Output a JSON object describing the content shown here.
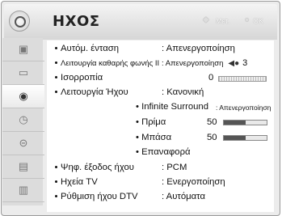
{
  "header": {
    "title": "ΗΧΟΣ",
    "hint_move": "Μετ.",
    "hint_ok": "OK"
  },
  "sidebar": {
    "items": [
      {
        "icon": "picture-icon"
      },
      {
        "icon": "sound-icon"
      },
      {
        "icon": "settings-icon"
      },
      {
        "icon": "time-icon"
      },
      {
        "icon": "lock-icon"
      },
      {
        "icon": "option-icon"
      },
      {
        "icon": "input-icon"
      }
    ],
    "active_index": 2
  },
  "menu": {
    "auto_volume": {
      "label": "Αυτόμ. ένταση",
      "value": ": Απενεργοποίηση"
    },
    "clear_voice": {
      "label": "Λειτουργία καθαρής φωνής ΙΙ",
      "value": ": Απενεργοποίηση",
      "level": "3"
    },
    "balance": {
      "label": "Ισορροπία",
      "value": "0",
      "level_fraction": 0.5
    },
    "sound_mode": {
      "label": "Λειτουργία Ήχου",
      "value": ": Κανονική"
    },
    "infinite_surround": {
      "label": "• Infinite Surround",
      "value": ": Απενεργοποίηση"
    },
    "treble": {
      "label": "• Πρίμα",
      "value": "50",
      "level_fraction": 0.5
    },
    "bass": {
      "label": "• Μπάσα",
      "value": "50",
      "level_fraction": 0.5
    },
    "reset": {
      "label": "• Επαναφορά"
    },
    "digital_out": {
      "label": "Ψηφ. έξοδος ήχου",
      "value": ": PCM"
    },
    "tv_speaker": {
      "label": "Ηχεία TV",
      "value": ": Ενεργοποίηση"
    },
    "dtv_audio": {
      "label": "Ρύθμιση ήχου DTV",
      "value": ": Αυτόματα"
    }
  }
}
